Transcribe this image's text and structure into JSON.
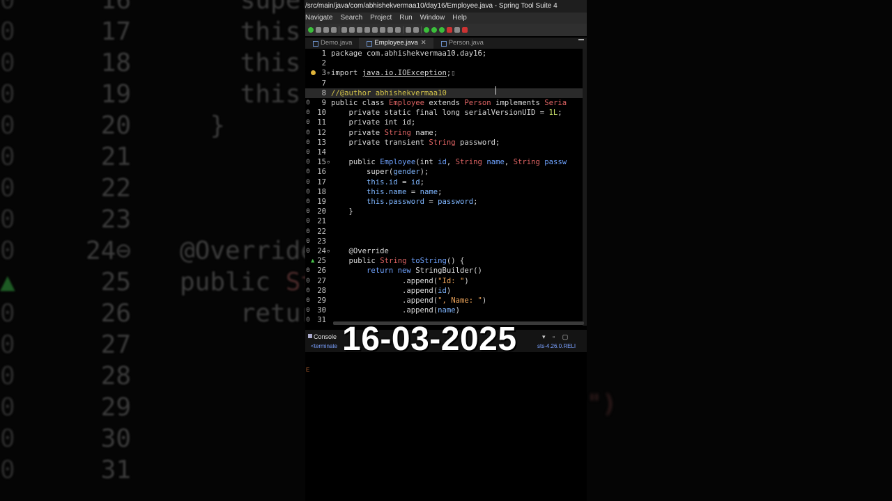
{
  "window": {
    "title": "/src/main/java/com/abhishekvermaa10/day16/Employee.java - Spring Tool Suite 4"
  },
  "menu": [
    "Navigate",
    "Search",
    "Project",
    "Run",
    "Window",
    "Help"
  ],
  "tabs": [
    {
      "label": "Demo.java",
      "active": false
    },
    {
      "label": "Employee.java",
      "active": true,
      "close": "✕"
    },
    {
      "label": "Person.java",
      "active": false
    }
  ],
  "editor": {
    "lines": [
      {
        "n": "1",
        "text": "package com.abhishekvermaa10.day16;"
      },
      {
        "n": "2",
        "text": ""
      },
      {
        "n": "3",
        "text": "import java.io.IOException;"
      },
      {
        "n": "7",
        "text": ""
      },
      {
        "n": "8",
        "text": "//@author abhishekvermaa10"
      },
      {
        "n": "9",
        "text": "public class Employee extends Person implements Seria"
      },
      {
        "n": "10",
        "text": "private static final long serialVersionUID = 1L;"
      },
      {
        "n": "11",
        "text": "private int id;"
      },
      {
        "n": "12",
        "text": "private String name;"
      },
      {
        "n": "13",
        "text": "private transient String password;"
      },
      {
        "n": "14",
        "text": ""
      },
      {
        "n": "15",
        "text": "public Employee(int id, String name, String passw"
      },
      {
        "n": "16",
        "text": "super(gender);"
      },
      {
        "n": "17",
        "text": "this.id = id;"
      },
      {
        "n": "18",
        "text": "this.name = name;"
      },
      {
        "n": "19",
        "text": "this.password = password;"
      },
      {
        "n": "20",
        "text": "}"
      },
      {
        "n": "21",
        "text": ""
      },
      {
        "n": "22",
        "text": ""
      },
      {
        "n": "23",
        "text": ""
      },
      {
        "n": "24",
        "text": "@Override"
      },
      {
        "n": "25",
        "text": "public String toString() {"
      },
      {
        "n": "26",
        "text": "return new StringBuilder()"
      },
      {
        "n": "27",
        "text": ".append(\"Id: \")"
      },
      {
        "n": "28",
        "text": ".append(id)"
      },
      {
        "n": "29",
        "text": ".append(\", Name: \")"
      },
      {
        "n": "30",
        "text": ".append(name)"
      },
      {
        "n": "31",
        "text": ""
      }
    ]
  },
  "console": {
    "tab": "Console",
    "status": "<terminate",
    "runtime": "sts-4.26.0.RELI"
  },
  "overlay": {
    "date": "16-03-2025"
  },
  "colors": {
    "keyword": "#cc7ee0",
    "type": "#e06464",
    "comment": "#d4c44a",
    "string": "#f2a85c",
    "field": "#7fb6ff"
  }
}
